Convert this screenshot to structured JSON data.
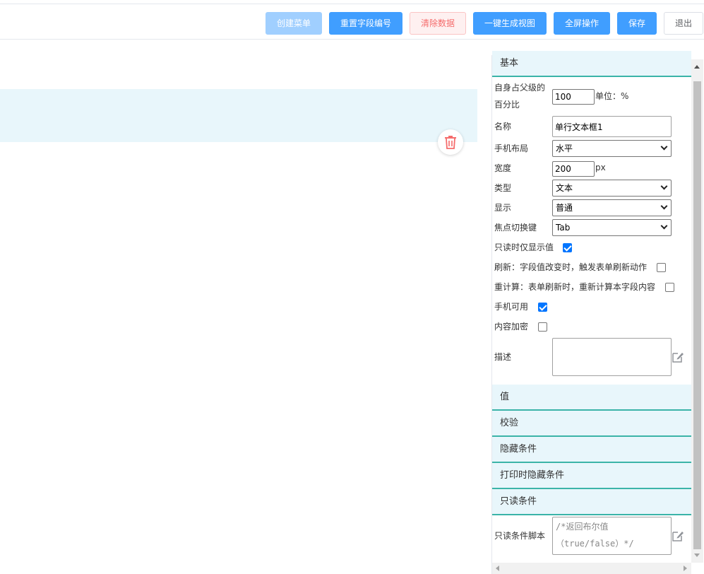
{
  "toolbar": {
    "create_menu": "创建菜单",
    "reset_field_no": "重置字段编号",
    "clear_data": "清除数据",
    "generate_view": "一键生成视图",
    "fullscreen": "全屏操作",
    "save": "保存",
    "exit": "退出"
  },
  "canvas": {
    "delete_icon": "trash-icon"
  },
  "panel": {
    "basic": {
      "title": "基本",
      "percent_label": "自身占父级的百分比",
      "percent_value": "100",
      "percent_unit": "单位：%",
      "name_label": "名称",
      "name_value": "单行文本框1",
      "mobile_layout_label": "手机布局",
      "mobile_layout_value": "水平",
      "width_label": "宽度",
      "width_value": "200",
      "width_unit": "px",
      "type_label": "类型",
      "type_value": "文本",
      "display_label": "显示",
      "display_value": "普通",
      "focus_key_label": "焦点切换键",
      "focus_key_value": "Tab",
      "readonly_show_value_label": "只读时仅显示值",
      "readonly_show_value": true,
      "refresh_label": "刷新：字段值改变时，触发表单刷新动作",
      "refresh": false,
      "recalc_label": "重计算：表单刷新时，重新计算本字段内容",
      "recalc": false,
      "mobile_enabled_label": "手机可用",
      "mobile_enabled": true,
      "encrypt_label": "内容加密",
      "encrypt": false,
      "desc_label": "描述",
      "desc_value": ""
    },
    "sections": {
      "value": "值",
      "validate": "校验",
      "hide_cond": "隐藏条件",
      "print_hide_cond": "打印时隐藏条件",
      "readonly_cond": "只读条件"
    },
    "readonly_script": {
      "label": "只读条件脚本",
      "placeholder_line1": "/*返回布尔值",
      "placeholder_line2": "（true/false）*/"
    }
  },
  "colors": {
    "primary": "#409eff",
    "section_border": "#3bb4a8",
    "section_bg": "#e8f6fb",
    "danger": "#f56c6c"
  }
}
